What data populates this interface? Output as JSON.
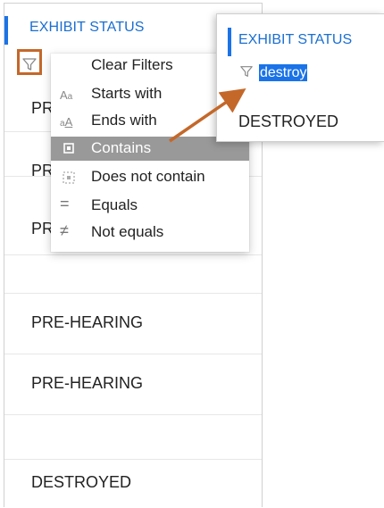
{
  "column": {
    "header": "EXHIBIT STATUS"
  },
  "rows": [
    {
      "text": "PRE-HEARING"
    },
    {
      "text": "PRE-HEARING"
    },
    {
      "text": "PRE-HEARING"
    },
    {
      "text": ""
    },
    {
      "text": "PRE-HEARING"
    },
    {
      "text": "PRE-HEARING"
    },
    {
      "text": ""
    },
    {
      "text": "DESTROYED"
    }
  ],
  "filter_menu": {
    "items": [
      {
        "label": "Clear Filters",
        "icon": ""
      },
      {
        "label": "Starts with",
        "icon": "Aa"
      },
      {
        "label": "Ends with",
        "icon": "aA"
      },
      {
        "label": "Contains",
        "icon": "contains-icon"
      },
      {
        "label": "Does not contain",
        "icon": "does-not-contain-icon"
      },
      {
        "label": "Equals",
        "icon": "="
      },
      {
        "label": "Not equals",
        "icon": "≠"
      }
    ],
    "selected": "Contains"
  },
  "popup": {
    "header": "EXHIBIT STATUS",
    "filter_value": "destroy",
    "result": "DESTROYED"
  },
  "colors": {
    "accent": "#1a73e8",
    "highlight": "#c4682a",
    "selected_bg": "#999999"
  }
}
